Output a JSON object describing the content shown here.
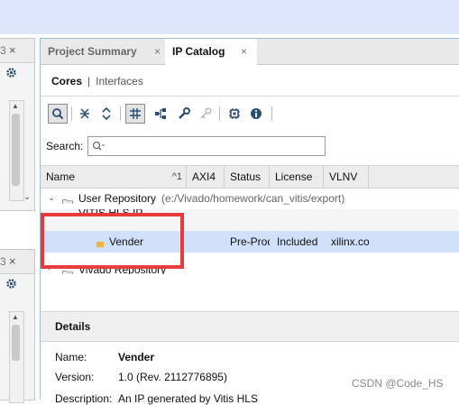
{
  "left_panels": [
    {
      "tab_tail": "3",
      "close_glyph": "×"
    },
    {
      "tab_tail": "3",
      "close_glyph": "×"
    }
  ],
  "tabs": [
    {
      "label": "Project Summary",
      "close_glyph": "×"
    },
    {
      "label": "IP Catalog",
      "close_glyph": "×"
    }
  ],
  "subtabs": {
    "cores": "Cores",
    "separator": "|",
    "interfaces": "Interfaces"
  },
  "toolbar": {
    "icons": [
      "search-icon",
      "collapse-all-icon",
      "expand-all-icon",
      "group-filter-icon",
      "hierarchy-icon",
      "wrench-icon",
      "key-icon",
      "chip-icon",
      "info-icon"
    ]
  },
  "search": {
    "label": "Search:",
    "value": "",
    "placeholder": "Q-"
  },
  "table": {
    "columns": [
      "Name",
      "AXI4",
      "Status",
      "License",
      "VLNV"
    ],
    "sort_indicator": "^1",
    "rows": [
      {
        "name": "User Repository",
        "path": "(e:/Vivado/homework/can_vitis/export)",
        "axi4": "",
        "status": "",
        "license": "",
        "vlnv": ""
      },
      {
        "name": "VITIS HLS IP",
        "path": "",
        "axi4": "",
        "status": "",
        "license": "",
        "vlnv": ""
      },
      {
        "name": "Vender",
        "path": "",
        "axi4": "",
        "status": "Pre-Production",
        "license": "Included",
        "vlnv": "xilinx.com"
      },
      {
        "name": "Vivado Repository",
        "path": "",
        "axi4": "",
        "status": "",
        "license": "",
        "vlnv": ""
      }
    ]
  },
  "details": {
    "title": "Details",
    "name_label": "Name:",
    "name_value": "Vender",
    "version_label": "Version:",
    "version_value": "1.0 (Rev. 2112776895)",
    "description_label": "Description:",
    "description_value": "An IP generated by Vitis HLS"
  },
  "watermark": "CSDN @Code_HS",
  "colors": {
    "top_banner": "#dfe6fc",
    "selected_row": "#cfe0f8",
    "annotation": "#e83a3a"
  }
}
